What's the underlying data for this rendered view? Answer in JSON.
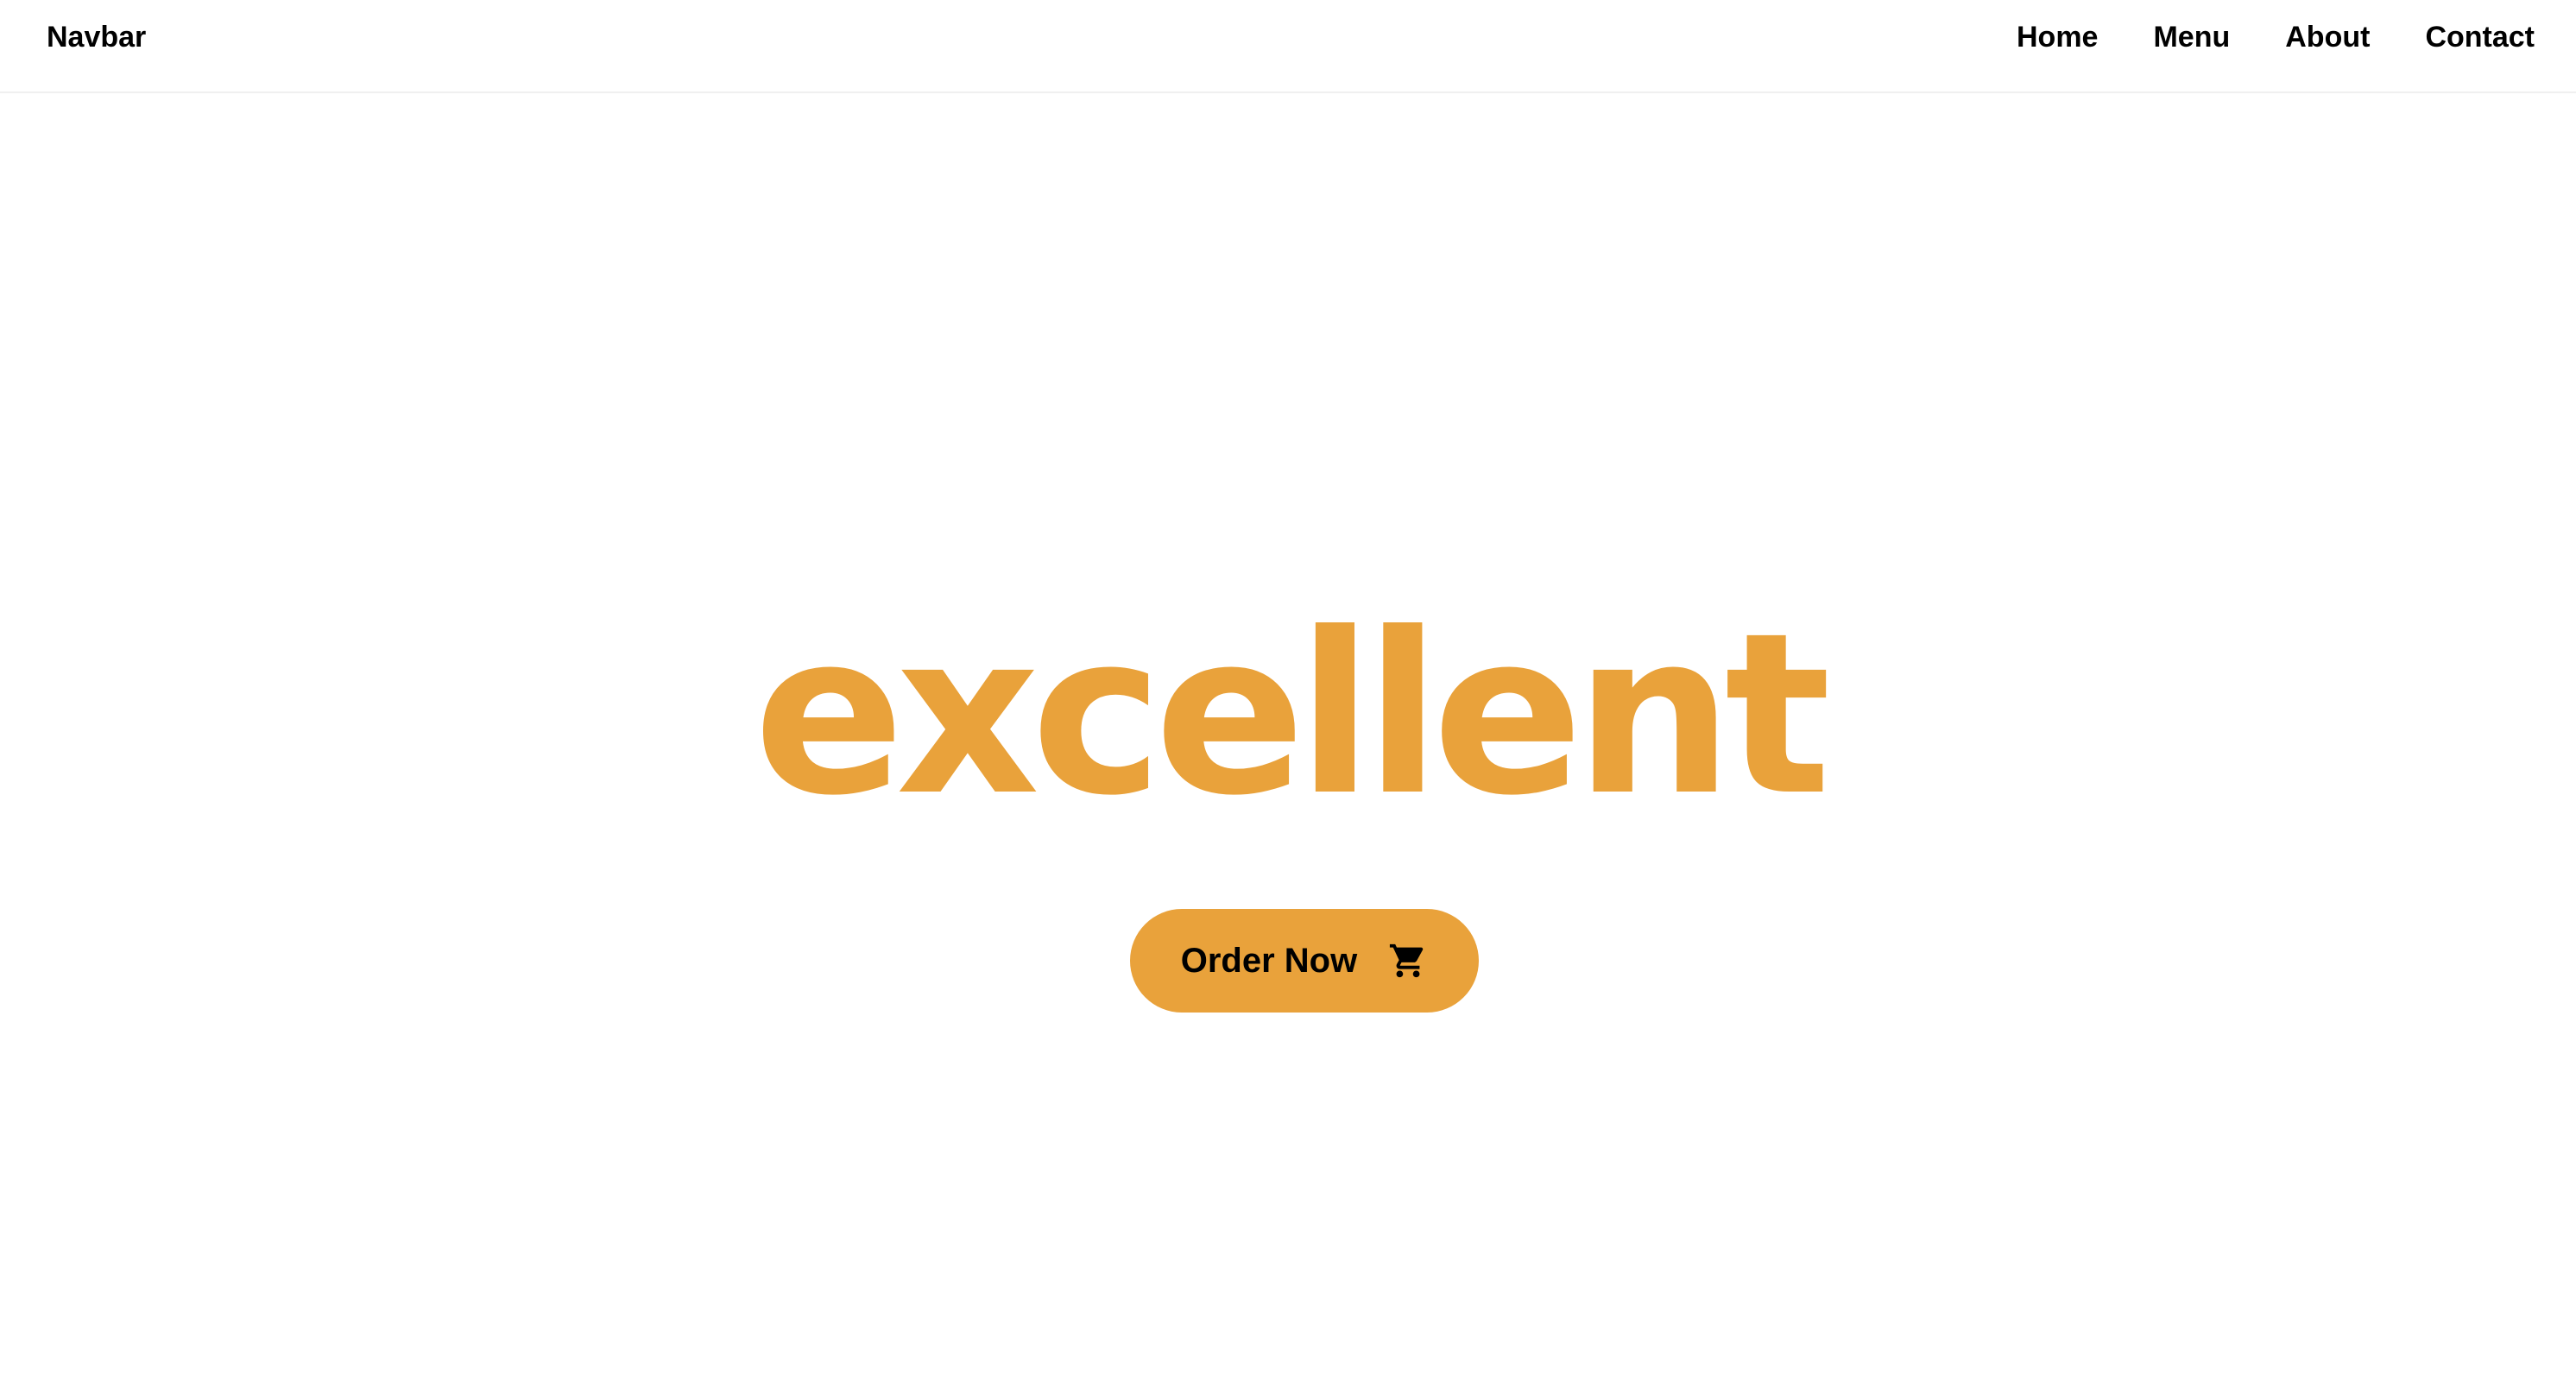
{
  "navbar": {
    "brand": "Navbar",
    "links": [
      {
        "label": "Home"
      },
      {
        "label": "Menu"
      },
      {
        "label": "About"
      },
      {
        "label": "Contact"
      }
    ]
  },
  "hero": {
    "headline": "excellent",
    "cta": {
      "label": "Order Now",
      "icon": "shopping-cart-icon"
    }
  },
  "colors": {
    "accent": "#e9a23b",
    "text": "#000000",
    "background": "#ffffff"
  }
}
